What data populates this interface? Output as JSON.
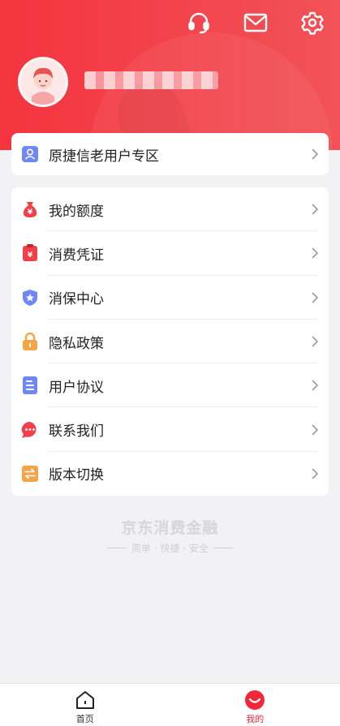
{
  "header": {
    "icons": [
      "headset-icon",
      "mail-icon",
      "gear-icon"
    ]
  },
  "profile": {
    "avatar": "avatar"
  },
  "old_user": {
    "label": "原捷信老用户专区",
    "icon": "user-badge-icon",
    "icon_color": "#6f88f5"
  },
  "menu": {
    "items": [
      {
        "label": "我的额度",
        "icon": "money-bag-icon",
        "color": "#f2404a"
      },
      {
        "label": "消费凭证",
        "icon": "receipt-icon",
        "color": "#f2404a"
      },
      {
        "label": "消保中心",
        "icon": "shield-star-icon",
        "color": "#6f88f5"
      },
      {
        "label": "隐私政策",
        "icon": "lock-icon",
        "color": "#f5a547"
      },
      {
        "label": "用户协议",
        "icon": "document-icon",
        "color": "#6f88f5"
      },
      {
        "label": "联系我们",
        "icon": "chat-bubble-icon",
        "color": "#f2404a"
      },
      {
        "label": "版本切换",
        "icon": "switch-arrows-icon",
        "color": "#f5a547"
      }
    ]
  },
  "footer": {
    "brand": "京东消费金融",
    "slogan": "简单 · 快捷 · 安全"
  },
  "tabbar": {
    "home_label": "首页",
    "mine_label": "我的",
    "active_color": "#f0283a"
  }
}
